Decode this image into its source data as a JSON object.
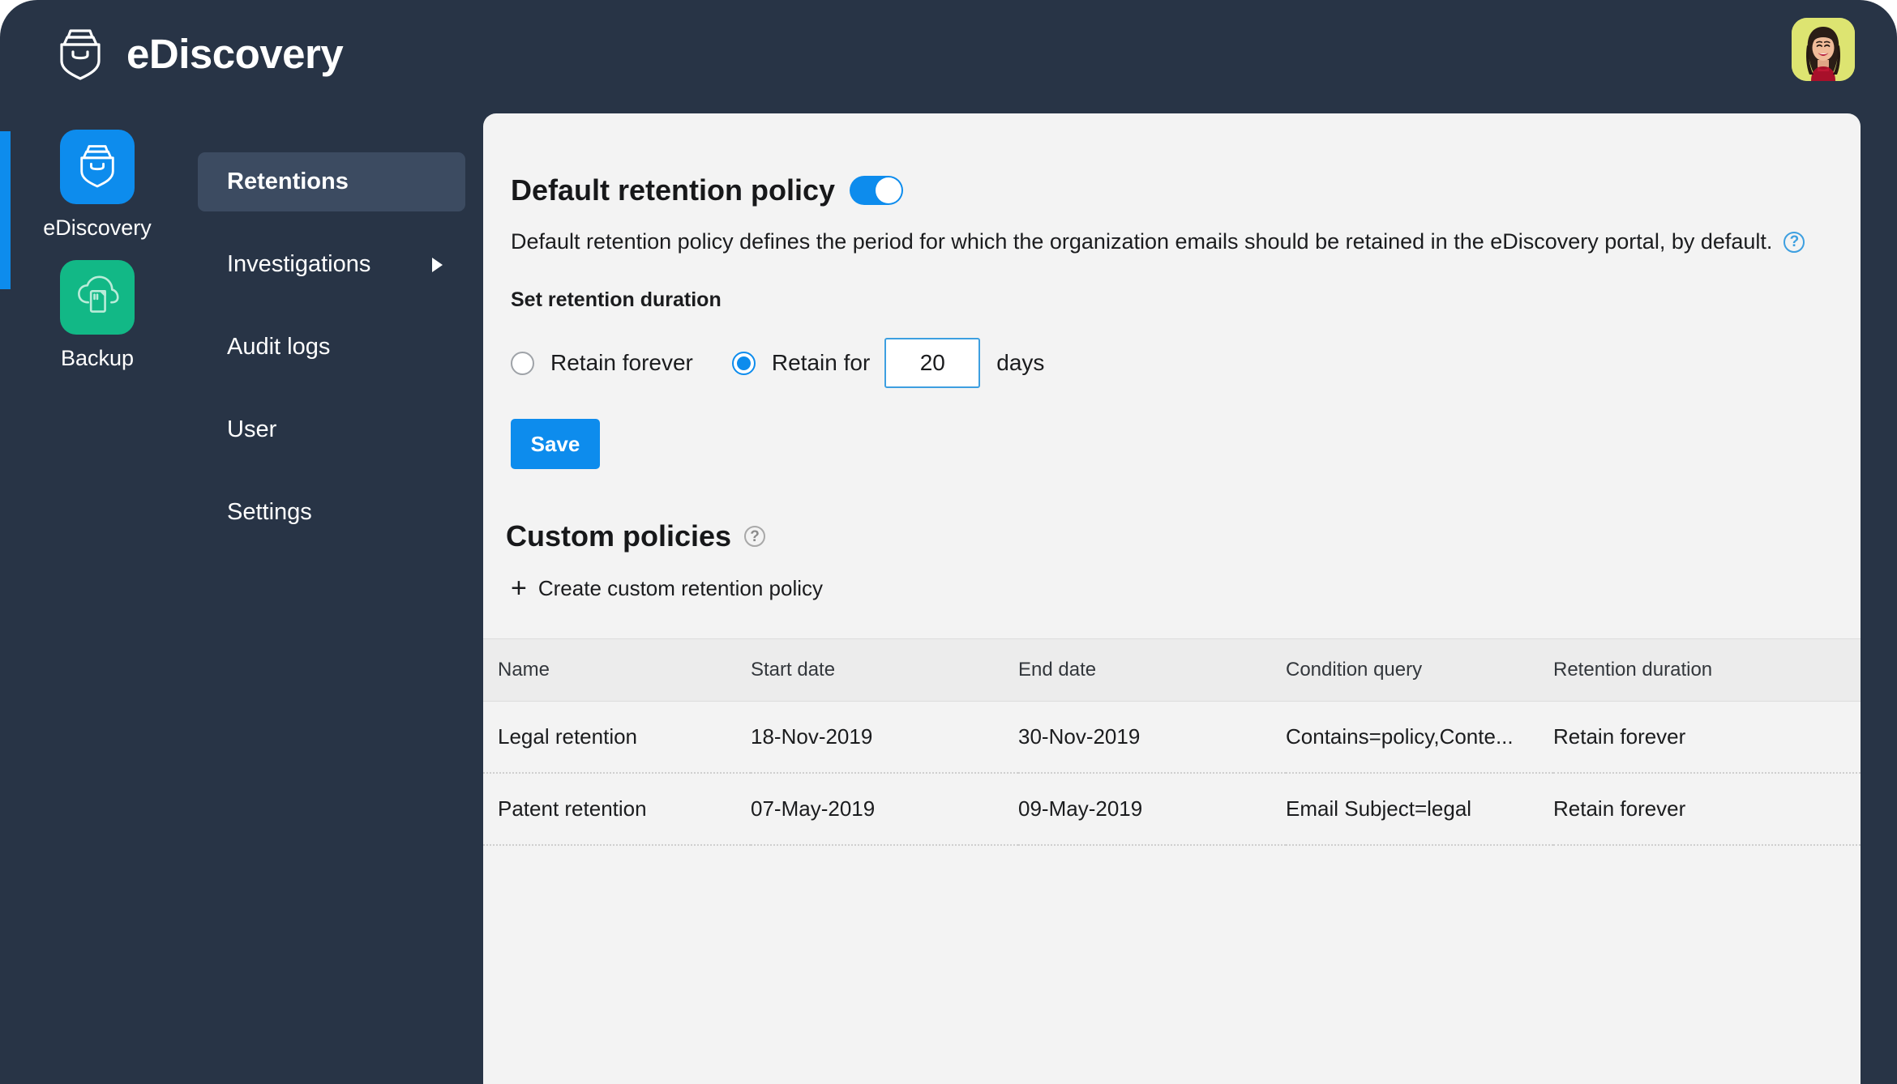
{
  "header": {
    "brand_title": "eDiscovery",
    "logo_icon": "ediscovery-shield-icon",
    "avatar_icon": "user-avatar-photo"
  },
  "rail": {
    "items": [
      {
        "label": "eDiscovery",
        "icon": "ediscovery-shield-icon",
        "active": true
      },
      {
        "label": "Backup",
        "icon": "cloud-backup-icon",
        "active": false
      }
    ]
  },
  "nav": {
    "items": [
      {
        "label": "Retentions",
        "active": true,
        "has_caret": false
      },
      {
        "label": "Investigations",
        "active": false,
        "has_caret": true
      },
      {
        "label": "Audit logs",
        "active": false,
        "has_caret": false
      },
      {
        "label": "User",
        "active": false,
        "has_caret": false
      },
      {
        "label": "Settings",
        "active": false,
        "has_caret": false
      }
    ]
  },
  "main": {
    "default_policy": {
      "title": "Default retention policy",
      "toggle_on": true,
      "description": "Default retention policy defines the period for which the organization emails should be retained in the eDiscovery portal, by default.",
      "help_icon": "help-circle-icon",
      "set_duration_label": "Set retention duration",
      "radio_forever_label": "Retain forever",
      "radio_forever_selected": false,
      "radio_for_label": "Retain for",
      "radio_for_selected": true,
      "days_value": "20",
      "days_placeholder": "0",
      "days_unit_label": "days",
      "save_label": "Save"
    },
    "custom_policies": {
      "title": "Custom policies",
      "help_icon": "help-circle-icon",
      "create_label": "Create custom retention policy",
      "create_icon": "plus-icon",
      "columns": [
        "Name",
        "Start date",
        "End date",
        "Condition query",
        "Retention duration"
      ],
      "rows": [
        {
          "name": "Legal retention",
          "start_date": "18-Nov-2019",
          "end_date": "30-Nov-2019",
          "condition_query": "Contains=policy,Conte...",
          "retention_duration": "Retain forever"
        },
        {
          "name": "Patent retention",
          "start_date": "07-May-2019",
          "end_date": "09-May-2019",
          "condition_query": "Email Subject=legal",
          "retention_duration": "Retain forever"
        }
      ]
    }
  },
  "colors": {
    "accent_blue": "#0d8ced",
    "dark_navy": "#283446",
    "nav_active": "#3c4b61",
    "backup_green": "#12b886",
    "panel_bg": "#f3f3f3",
    "avatar_bg": "#dde471"
  }
}
